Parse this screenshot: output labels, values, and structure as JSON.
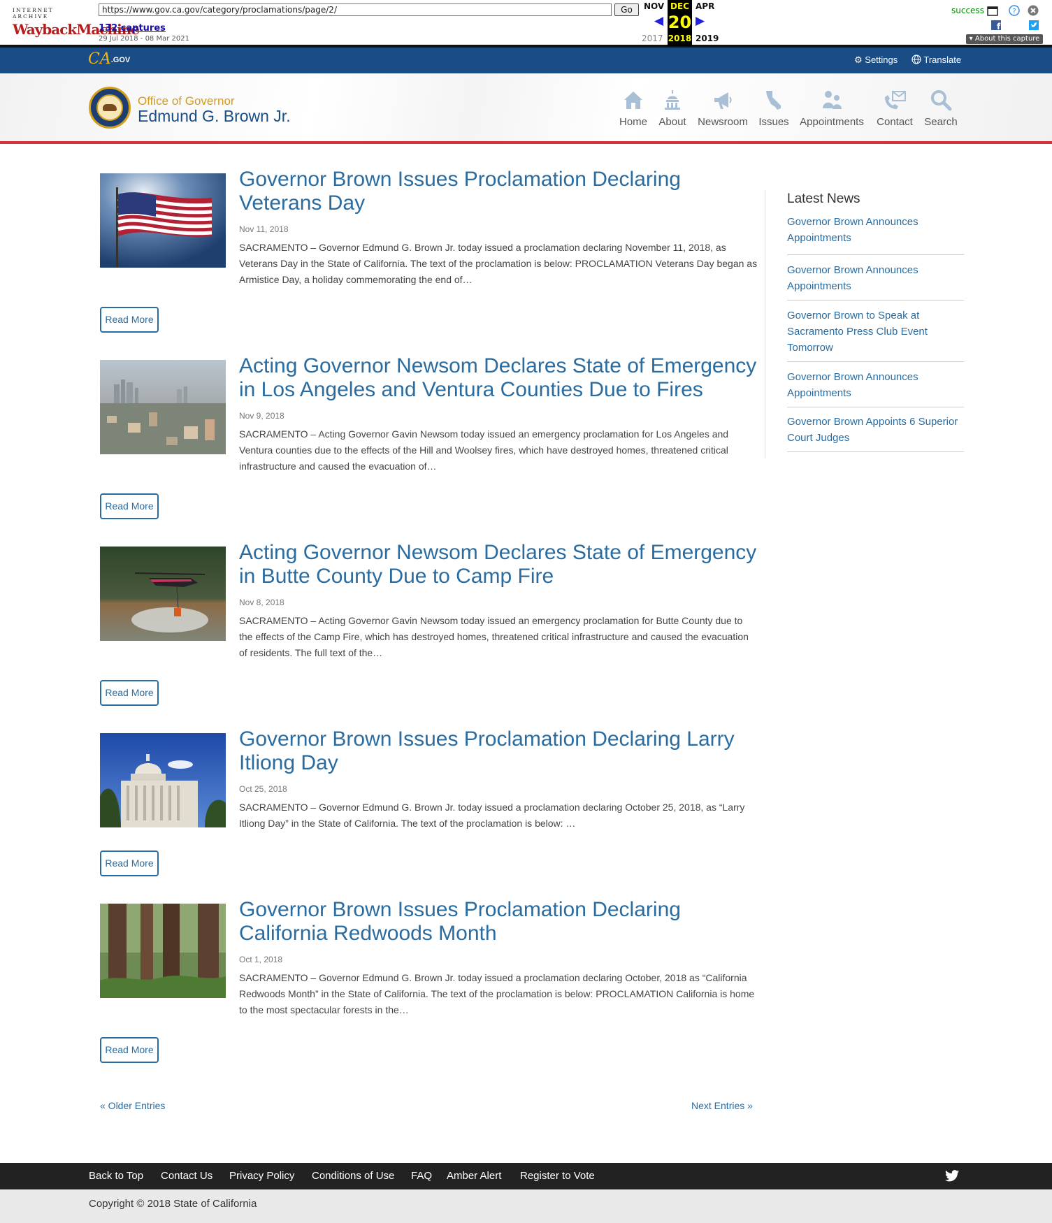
{
  "wayback": {
    "logo_top": "INTERNET ARCHIVE",
    "logo_main": "WaybackMachine",
    "url": "https://www.gov.ca.gov/category/proclamations/page/2/",
    "go_label": "Go",
    "captures": "132 captures",
    "date_span": "29 Jul 2018 - 08 Mar 2021",
    "prev_month": "NOV",
    "cur_month": "DEC",
    "next_month": "APR",
    "cur_day": "20",
    "prev_year": "2017",
    "cur_year": "2018",
    "next_year": "2019",
    "status": "success",
    "about_label": "About this capture"
  },
  "utility": {
    "logo_text": "CA",
    "logo_suffix": ".GOV",
    "settings_label": "Settings",
    "translate_label": "Translate"
  },
  "header": {
    "org_line1": "Office of Governor",
    "org_line2": "Edmund G. Brown Jr.",
    "nav": [
      {
        "label": "Home",
        "icon": "home-icon"
      },
      {
        "label": "About",
        "icon": "capitol-icon"
      },
      {
        "label": "Newsroom",
        "icon": "megaphone-icon"
      },
      {
        "label": "Issues",
        "icon": "california-icon"
      },
      {
        "label": "Appointments",
        "icon": "people-icon"
      },
      {
        "label": "Contact",
        "icon": "phone-mail-icon"
      },
      {
        "label": "Search",
        "icon": "search-icon"
      }
    ]
  },
  "posts": [
    {
      "title": "Governor Brown Issues Proclamation Declaring Veterans Day",
      "date": "Nov 11, 2018",
      "excerpt": "SACRAMENTO – Governor Edmund G. Brown Jr. today issued a proclamation declaring November 11, 2018, as Veterans Day in the State of California. The text of the proclamation is below: PROCLAMATION Veterans Day began as Armistice Day, a holiday commemorating the end of…",
      "more": "Read More"
    },
    {
      "title": "Acting Governor Newsom Declares State of Emergency in Los Angeles and Ventura Counties Due to Fires",
      "date": "Nov 9, 2018",
      "excerpt": "SACRAMENTO – Acting Governor Gavin Newsom today issued an emergency proclamation for Los Angeles and Ventura counties due to the effects of the Hill and Woolsey fires, which have destroyed homes, threatened critical infrastructure and caused the evacuation of…",
      "more": "Read More"
    },
    {
      "title": "Acting Governor Newsom Declares State of Emergency in Butte County Due to Camp Fire",
      "date": "Nov 8, 2018",
      "excerpt": "SACRAMENTO – Acting Governor Gavin Newsom today issued an emergency proclamation for Butte County due to the effects of the Camp Fire, which has destroyed homes, threatened critical infrastructure and caused the evacuation of residents. The full text of the…",
      "more": "Read More"
    },
    {
      "title": "Governor Brown Issues Proclamation Declaring Larry Itliong Day",
      "date": "Oct 25, 2018",
      "excerpt": "SACRAMENTO – Governor Edmund G. Brown Jr. today issued a proclamation declaring October 25, 2018, as “Larry Itliong Day” in the State of California. The text of the proclamation is below:  …",
      "more": "Read More"
    },
    {
      "title": "Governor Brown Issues Proclamation Declaring California Redwoods Month",
      "date": "Oct 1, 2018",
      "excerpt": "SACRAMENTO – Governor Edmund G. Brown Jr. today issued a proclamation declaring October, 2018 as “California Redwoods Month” in the State of California. The text of the proclamation is below: PROCLAMATION California is home to the most spectacular forests in the…",
      "more": "Read More"
    }
  ],
  "pagination": {
    "older": "« Older Entries",
    "newer": "Next Entries »"
  },
  "sidebar": {
    "title": "Latest News",
    "items": [
      "Governor Brown Announces Appointments",
      "Governor Brown Announces Appointments",
      "Governor Brown to Speak at Sacramento Press Club Event Tomorrow",
      "Governor Brown Announces Appointments",
      "Governor Brown Appoints 6 Superior Court Judges"
    ]
  },
  "footer": {
    "links": [
      "Back to Top",
      "Contact Us",
      "Privacy Policy",
      "Conditions of Use",
      "FAQ",
      "Amber Alert",
      "Register to Vote"
    ],
    "copyright": "Copyright © 2018 State of California"
  },
  "colors": {
    "brand_blue": "#1a4d85",
    "link_blue": "#2a6ca0",
    "accent_red": "#d2323a",
    "gold": "#d49b1a"
  }
}
